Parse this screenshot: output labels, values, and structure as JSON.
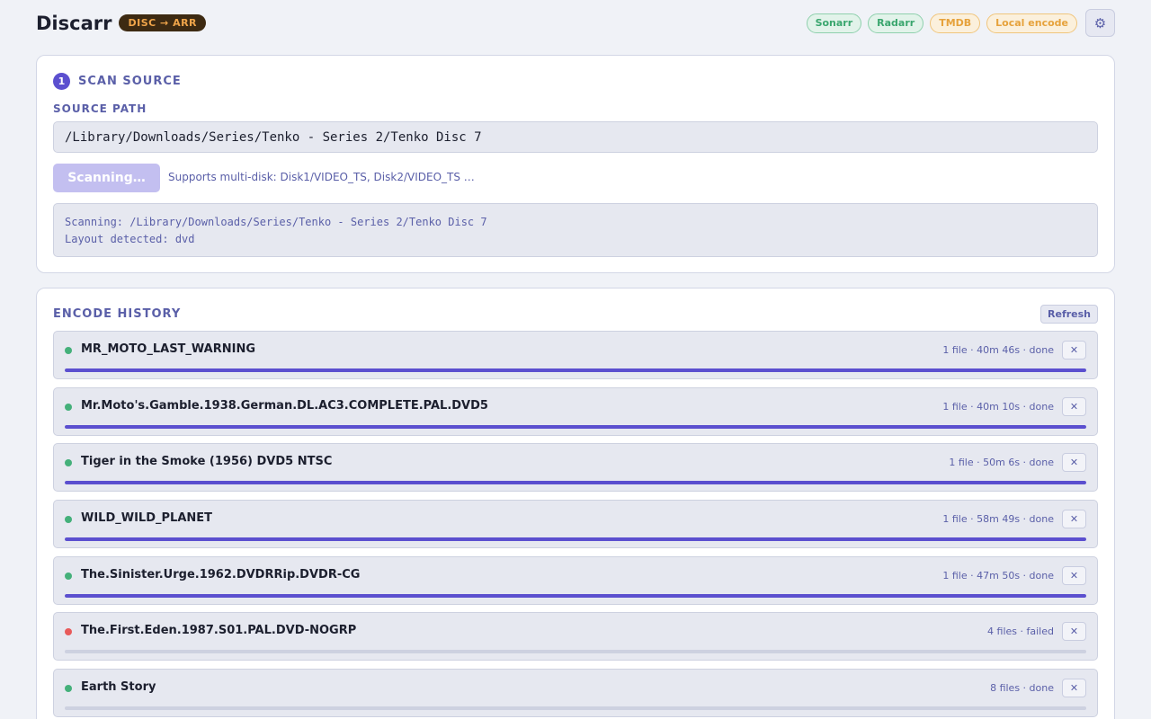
{
  "header": {
    "title": "Discarr",
    "badge": "DISC → ARR",
    "services": [
      {
        "label": "Sonarr",
        "status": "ok"
      },
      {
        "label": "Radarr",
        "status": "ok"
      },
      {
        "label": "TMDB",
        "status": "warn"
      },
      {
        "label": "Local encode",
        "status": "warn"
      }
    ],
    "settings_icon": "gear-icon",
    "settings_glyph": "⚙"
  },
  "scan": {
    "step_number": "1",
    "title": "SCAN SOURCE",
    "path_label": "SOURCE PATH",
    "path_value": "/Library/Downloads/Series/Tenko - Series 2/Tenko Disc 7",
    "button_label": "Scanning…",
    "hint": "Supports multi-disk: Disk1/VIDEO_TS, Disk2/VIDEO_TS …",
    "log": [
      "Scanning: /Library/Downloads/Series/Tenko - Series 2/Tenko Disc 7",
      "Layout detected: dvd"
    ]
  },
  "history": {
    "title": "ENCODE HISTORY",
    "refresh_label": "Refresh",
    "remove_glyph": "✕",
    "jobs": [
      {
        "name": "MR_MOTO_LAST_WARNING",
        "meta": "1 file · 40m 46s · done",
        "status": "done",
        "progress": 1.0
      },
      {
        "name": "Mr.Moto's.Gamble.1938.German.DL.AC3.COMPLETE.PAL.DVD5",
        "meta": "1 file · 40m 10s · done",
        "status": "done",
        "progress": 1.0
      },
      {
        "name": "Tiger in the Smoke (1956) DVD5 NTSC",
        "meta": "1 file · 50m 6s · done",
        "status": "done",
        "progress": 1.0
      },
      {
        "name": "WILD_WILD_PLANET",
        "meta": "1 file · 58m 49s · done",
        "status": "done",
        "progress": 1.0
      },
      {
        "name": "The.Sinister.Urge.1962.DVDRRip.DVDR-CG",
        "meta": "1 file · 47m 50s · done",
        "status": "done",
        "progress": 1.0
      },
      {
        "name": "The.First.Eden.1987.S01.PAL.DVD-NOGRP",
        "meta": "4 files · failed",
        "status": "failed",
        "progress": 0
      },
      {
        "name": "Earth Story",
        "meta": "8 files · done",
        "status": "done",
        "progress": 0
      }
    ]
  }
}
